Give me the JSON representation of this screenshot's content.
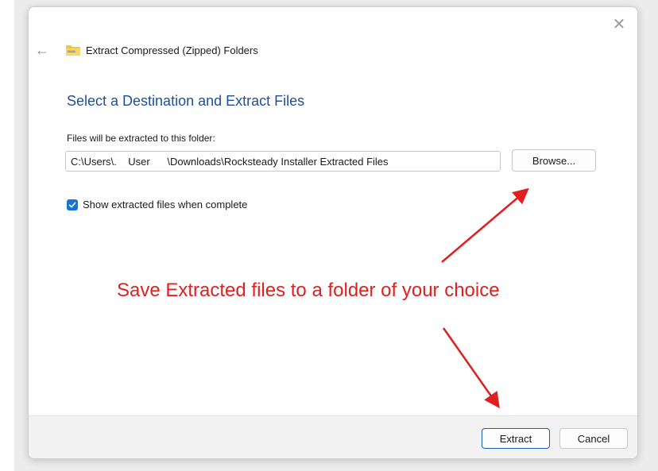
{
  "dialog": {
    "header_title": "Extract Compressed (Zipped) Folders",
    "section_title": "Select a Destination and Extract Files",
    "field_label": "Files will be extracted to this folder:",
    "path_value": "C:\\Users\\.    User      \\Downloads\\Rocksteady Installer Extracted Files",
    "browse_label": "Browse...",
    "checkbox_label": "Show extracted files when complete",
    "checkbox_checked": true,
    "extract_label": "Extract",
    "cancel_label": "Cancel"
  },
  "icons": {
    "close": "close-icon",
    "back": "back-arrow-icon",
    "folder": "zip-folder-icon",
    "check": "checkmark-icon"
  },
  "annotation": {
    "text": "Save Extracted files to a folder of your choice",
    "color": "#e02020"
  },
  "colors": {
    "accent": "#1a73d2",
    "title_blue": "#1f4e9a"
  }
}
